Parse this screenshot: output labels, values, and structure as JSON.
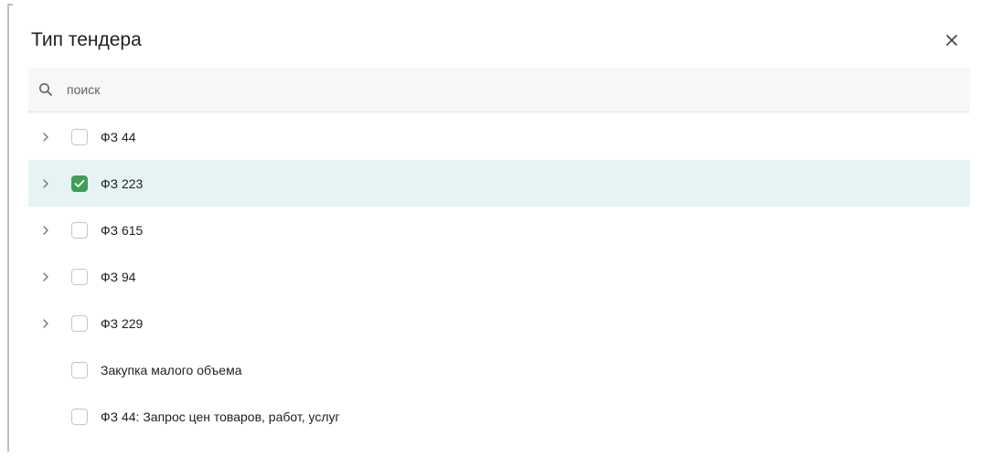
{
  "dialog": {
    "title": "Тип тендера",
    "close_icon": "close-icon"
  },
  "search": {
    "icon": "search-icon",
    "placeholder": "поиск",
    "value": ""
  },
  "items": [
    {
      "label": "ФЗ 44",
      "expandable": true,
      "checked": false
    },
    {
      "label": "ФЗ 223",
      "expandable": true,
      "checked": true
    },
    {
      "label": "ФЗ 615",
      "expandable": true,
      "checked": false
    },
    {
      "label": "ФЗ 94",
      "expandable": true,
      "checked": false
    },
    {
      "label": "ФЗ 229",
      "expandable": true,
      "checked": false
    },
    {
      "label": "Закупка малого объема",
      "expandable": false,
      "checked": false
    },
    {
      "label": "ФЗ 44: Запрос цен товаров, работ, услуг",
      "expandable": false,
      "checked": false
    }
  ],
  "colors": {
    "selected_row_bg": "#e6f3f3",
    "checkbox_checked": "#3f9f5a",
    "search_bg": "#f7f7f7"
  }
}
